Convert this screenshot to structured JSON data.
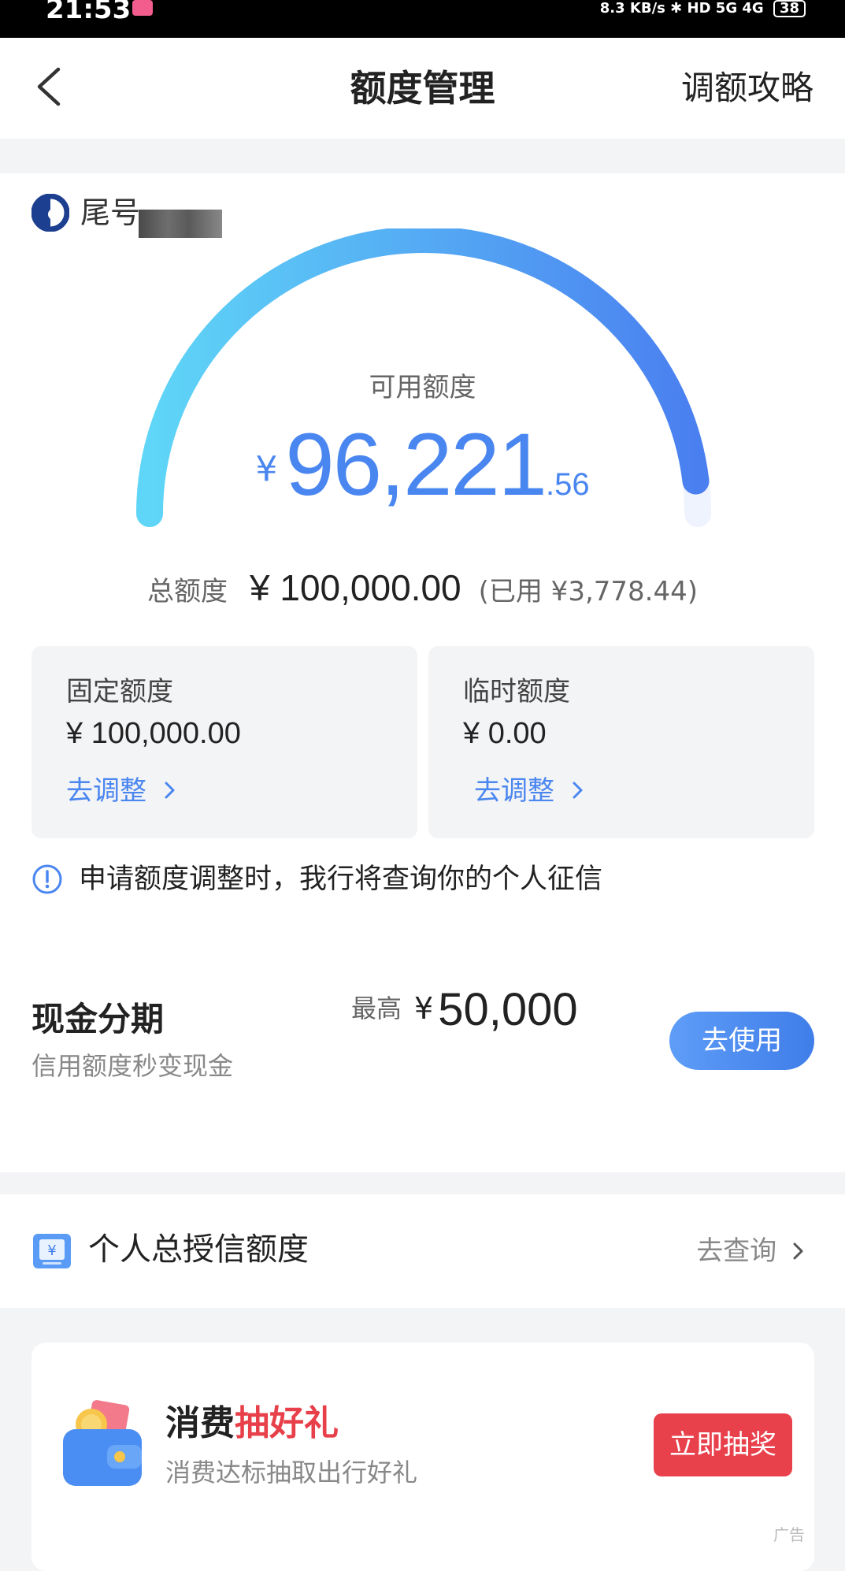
{
  "status_bar": {
    "time": "21:53",
    "network_speed": "8.3 KB/s",
    "indicators": "HD 5G 4G",
    "battery": "38"
  },
  "header": {
    "title": "额度管理",
    "right_link": "调额攻略",
    "back_icon": "chevron-left-icon"
  },
  "account": {
    "tail_label": "尾号"
  },
  "available": {
    "label": "可用额度",
    "currency": "¥",
    "integer": "96,221",
    "decimal": ".56",
    "gauge_fraction": 0.962
  },
  "total": {
    "label": "总额度",
    "amount": "¥ 100,000.00",
    "used_note": "(已用 ¥3,778.44)"
  },
  "fixed_quota": {
    "title": "固定额度",
    "amount": "¥ 100,000.00",
    "link": "去调整"
  },
  "temp_quota": {
    "title": "临时额度",
    "amount": "¥ 0.00",
    "link": "去调整"
  },
  "notice": {
    "text": "申请额度调整时，我行将查询你的个人征信"
  },
  "cash_installment": {
    "title": "现金分期",
    "subtitle": "信用额度秒变现金",
    "max_label": "最高",
    "max_currency": "¥",
    "max_amount": "50,000",
    "button": "去使用"
  },
  "credit": {
    "title": "个人总授信额度",
    "link": "去查询"
  },
  "promo": {
    "title_black": "消费",
    "title_red": "抽好礼",
    "subtitle": "消费达标抽取出行好礼",
    "button": "立即抽奖",
    "ad_label": "广告"
  },
  "colors": {
    "accent_blue": "#4a86f0",
    "promo_red": "#e8414c",
    "background": "#f3f4f6"
  }
}
